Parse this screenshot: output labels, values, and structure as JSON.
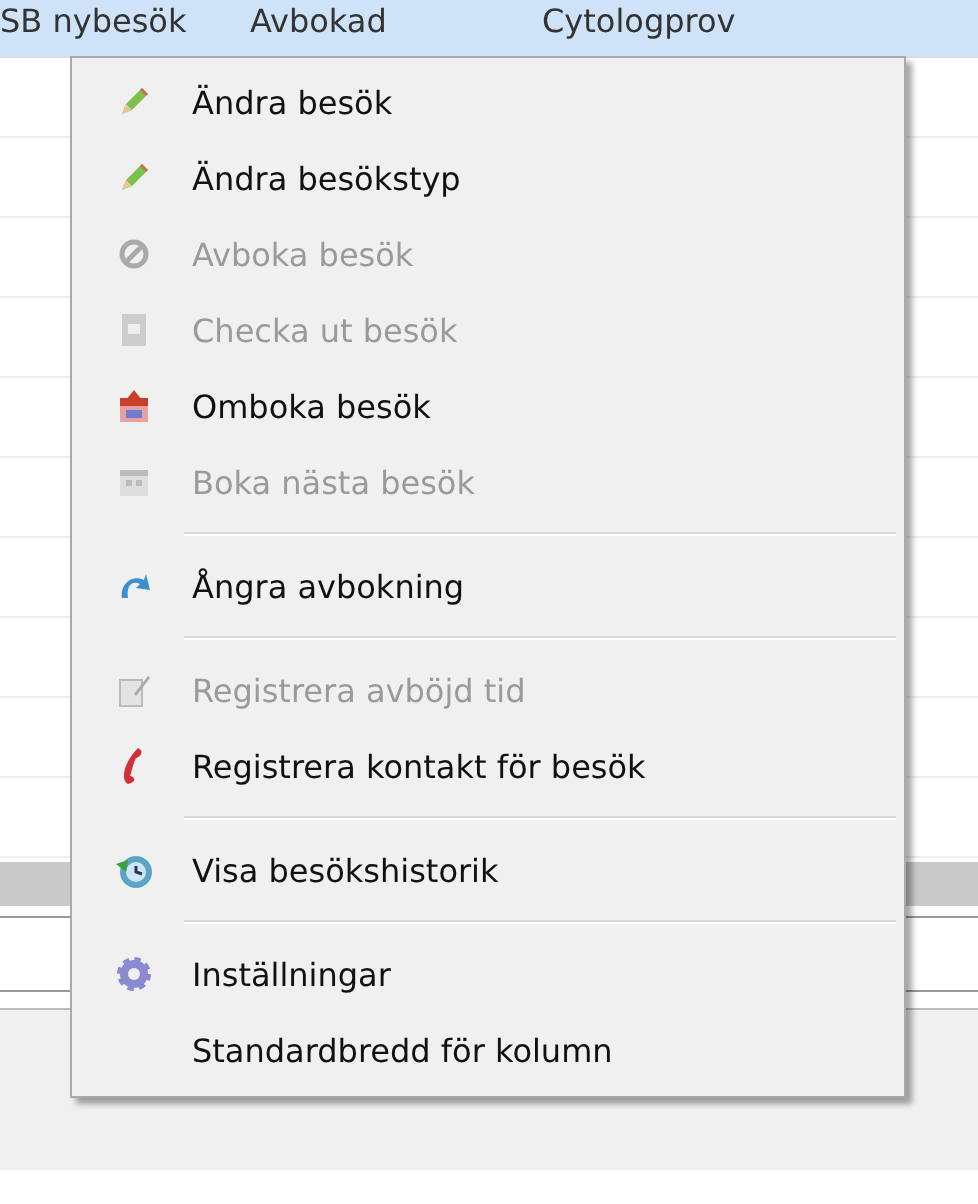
{
  "table": {
    "header_row": {
      "selected": true,
      "cells": [
        "SB nybesök",
        "Avbokad",
        "Cytologprov"
      ]
    }
  },
  "context_menu": {
    "items": [
      {
        "kind": "item",
        "label": "Ändra besök",
        "disabled": false
      },
      {
        "kind": "item",
        "label": "Ändra besökstyp",
        "disabled": false
      },
      {
        "kind": "item",
        "label": "Avboka besök",
        "disabled": true
      },
      {
        "kind": "item",
        "label": "Checka ut besök",
        "disabled": true
      },
      {
        "kind": "item",
        "label": "Omboka besök",
        "disabled": false
      },
      {
        "kind": "item",
        "label": "Boka nästa besök",
        "disabled": true
      },
      {
        "kind": "separator"
      },
      {
        "kind": "item",
        "label": "Ångra avbokning",
        "disabled": false
      },
      {
        "kind": "separator"
      },
      {
        "kind": "item",
        "label": "Registrera avböjd tid",
        "disabled": true
      },
      {
        "kind": "item",
        "label": "Registrera kontakt för besök",
        "disabled": false
      },
      {
        "kind": "separator"
      },
      {
        "kind": "item",
        "label": "Visa besökshistorik",
        "disabled": false
      },
      {
        "kind": "separator"
      },
      {
        "kind": "item",
        "label": "Inställningar",
        "disabled": false
      },
      {
        "kind": "item",
        "label": "Standardbredd för kolumn",
        "disabled": false
      }
    ]
  }
}
